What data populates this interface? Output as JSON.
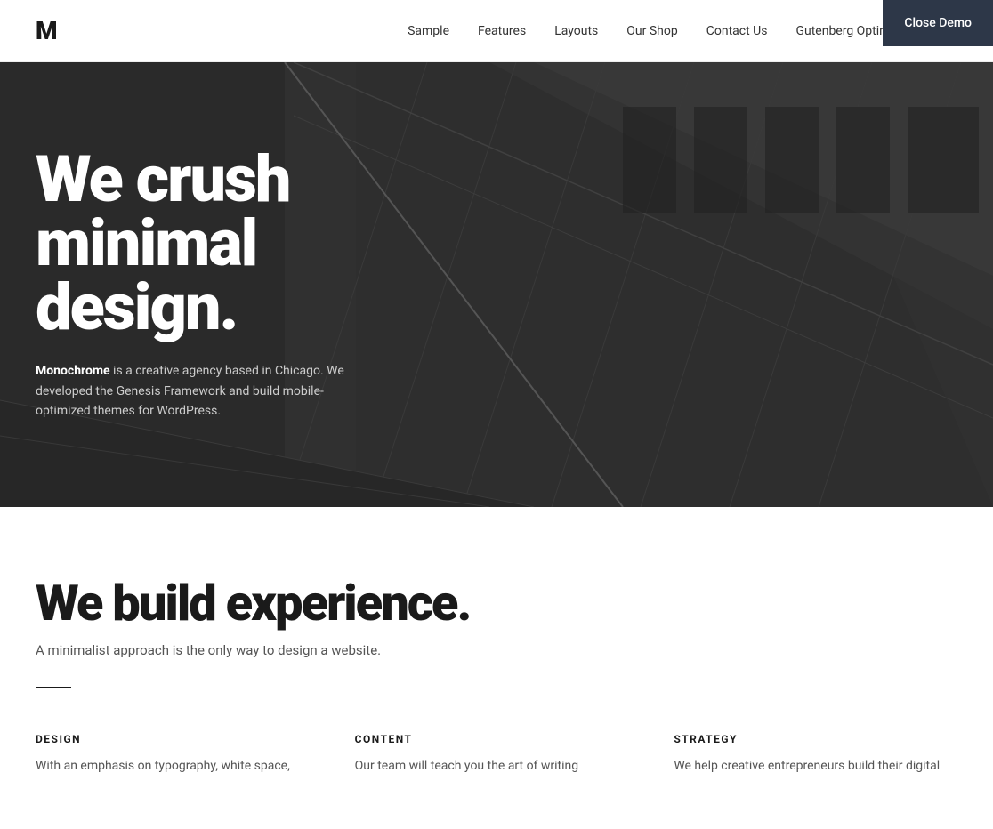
{
  "close_demo": {
    "label": "Close Demo"
  },
  "header": {
    "logo": "M",
    "nav_items": [
      {
        "label": "Sample",
        "id": "sample"
      },
      {
        "label": "Features",
        "id": "features"
      },
      {
        "label": "Layouts",
        "id": "layouts"
      },
      {
        "label": "Our Shop",
        "id": "our-shop"
      },
      {
        "label": "Contact Us",
        "id": "contact-us"
      },
      {
        "label": "Gutenberg Optimized",
        "id": "gutenberg"
      }
    ]
  },
  "hero": {
    "title": "We crush minimal design.",
    "description_brand": "Monochrome",
    "description_text": " is a creative agency based in Chicago. We developed the Genesis Framework and build mobile-optimized themes for WordPress."
  },
  "main": {
    "section_title": "We build experience.",
    "section_subtitle": "A minimalist approach is the only way to design a website.",
    "columns": [
      {
        "heading": "DESIGN",
        "text": "With an emphasis on typography, white space,"
      },
      {
        "heading": "CONTENT",
        "text": "Our team will teach you the art of writing"
      },
      {
        "heading": "STRATEGY",
        "text": "We help creative entrepreneurs build their digital"
      }
    ]
  }
}
